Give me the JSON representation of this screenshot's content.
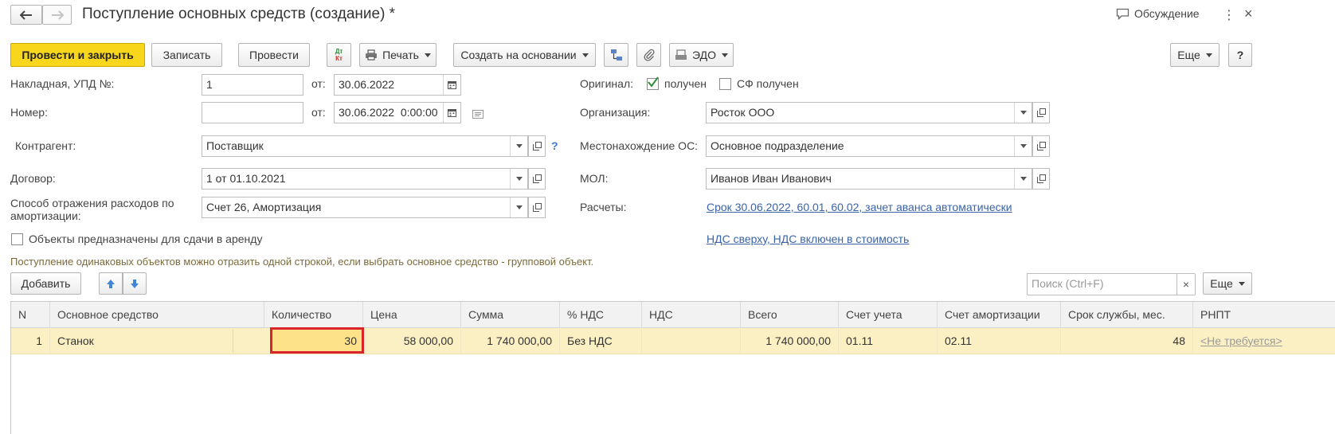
{
  "header": {
    "title": "Поступление основных средств (создание) *",
    "discussion_label": "Обсуждение"
  },
  "toolbar": {
    "post_and_close": "Провести и закрыть",
    "save": "Записать",
    "post": "Провести",
    "dtkt_top": "Дт",
    "dtkt_bottom": "Кт",
    "print": "Печать",
    "create_based_on": "Создать на основании",
    "edo": "ЭДО",
    "more": "Еще",
    "help": "?"
  },
  "form": {
    "invoice_label": "Накладная, УПД №:",
    "invoice_value": "1",
    "from_label": "от:",
    "invoice_date": "30.06.2022",
    "number_label": "Номер:",
    "number_value": "",
    "from_label2": "от:",
    "number_date": "30.06.2022  0:00:00",
    "contractor_label": "Контрагент:",
    "contractor_value": "Поставщик",
    "contractor_help": "?",
    "contract_label": "Договор:",
    "contract_value": "1 от 01.10.2021",
    "depr_label_line1": "Способ отражения расходов по",
    "depr_label_line2": "амортизации:",
    "depr_value": "Счет 26, Амортизация",
    "rent_checkbox_label": "Объекты предназначены для сдачи в аренду",
    "rent_checked": false,
    "original_label": "Оригинал:",
    "received_label": "получен",
    "received_checked": true,
    "sf_received_label": "СФ получен",
    "sf_received_checked": false,
    "org_label": "Организация:",
    "org_value": "Росток ООО",
    "location_label": "Местонахождение ОС:",
    "location_value": "Основное подразделение",
    "mol_label": "МОЛ:",
    "mol_value": "Иванов Иван Иванович",
    "settlements_label": "Расчеты:",
    "settlements_link": "Срок 30.06.2022, 60.01, 60.02, зачет аванса автоматически",
    "vat_link": "НДС сверху, НДС включен в стоимость"
  },
  "hint": "Поступление одинаковых объектов можно отразить одной строкой, если выбрать основное средство - групповой объект.",
  "table_toolbar": {
    "add": "Добавить",
    "search_placeholder": "Поиск (Ctrl+F)",
    "clear": "×",
    "more": "Еще"
  },
  "table": {
    "columns": [
      "N",
      "Основное средство",
      "Количество",
      "Цена",
      "Сумма",
      "% НДС",
      "НДС",
      "Всего",
      "Счет учета",
      "Счет амортизации",
      "Срок службы, мес.",
      "РНПТ"
    ],
    "rows": [
      {
        "n": "1",
        "asset": "Станок",
        "qty": "30",
        "price": "58 000,00",
        "sum": "1 740 000,00",
        "vat_rate": "Без НДС",
        "vat": "",
        "total": "1 740 000,00",
        "account": "01.11",
        "depr_account": "02.11",
        "life": "48",
        "rnpt": "<Не требуется>"
      }
    ]
  },
  "colors": {
    "accent_yellow": "#f7d61b",
    "row_highlight": "#fbf0c4",
    "selected_cell": "#fde28a",
    "highlight_border": "#d8242a",
    "link": "#3a63a8"
  }
}
